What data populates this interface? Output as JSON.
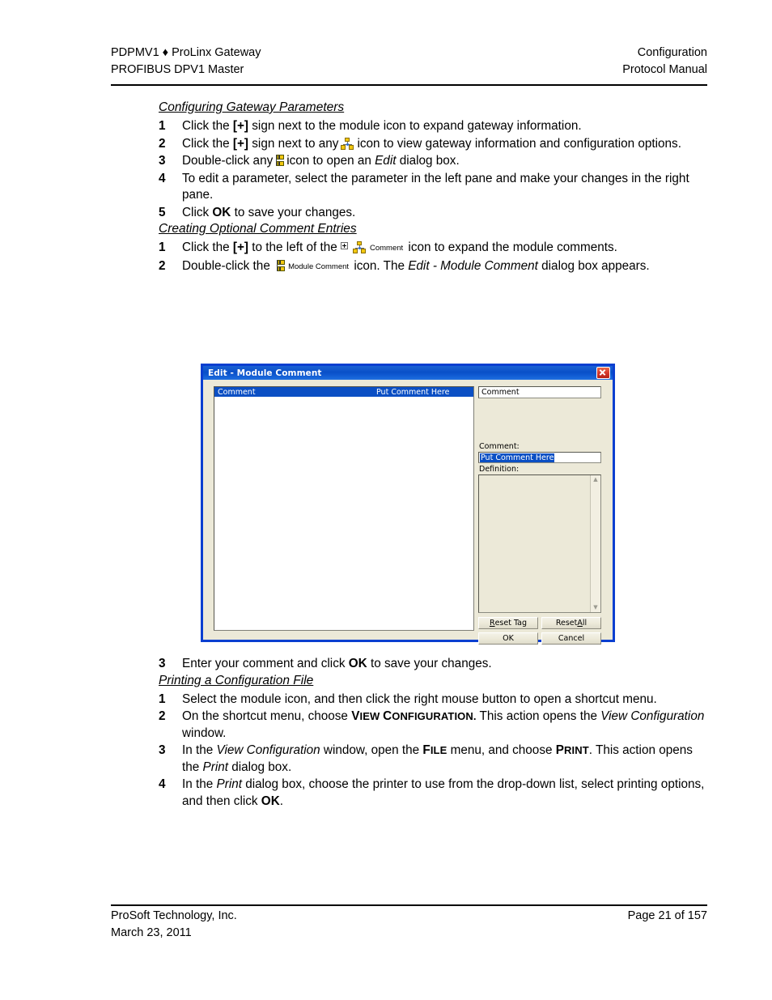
{
  "header": {
    "left_line1": "PDPMV1 ♦ ProLinx Gateway",
    "left_line2": "PROFIBUS DPV1 Master",
    "right_line1": "Configuration",
    "right_line2": "Protocol Manual"
  },
  "sections": [
    {
      "title": "Configuring Gateway Parameters",
      "steps": [
        {
          "num": "1",
          "text": "Click the [+] sign next to the module icon to expand gateway information."
        },
        {
          "num": "2",
          "text": "Click the [+] sign next to any (tree icon) icon to view gateway information and configuration options."
        },
        {
          "num": "3",
          "text": "Double-click any (parameter icon) icon to open an Edit dialog box."
        },
        {
          "num": "4",
          "text": "To edit a parameter, select the parameter in the left pane and make your changes in the right pane."
        },
        {
          "num": "5",
          "text": "Click OK to save your changes."
        }
      ]
    },
    {
      "title": "Creating Optional Comment Entries",
      "steps": [
        {
          "num": "1",
          "text": "Click the [+] to the left of the Comment icon to expand the module comments."
        },
        {
          "num": "2",
          "text": "Double-click the Module Comment icon. The Edit - Module Comment dialog box appears."
        },
        {
          "num": "3",
          "text": "Enter your comment and click OK to save your changes."
        }
      ]
    },
    {
      "title": "Printing a Configuration File",
      "steps": [
        {
          "num": "1",
          "text": "Select the module icon, and then click the right mouse button to open a shortcut menu."
        },
        {
          "num": "2",
          "text": "On the shortcut menu, choose VIEW CONFIGURATION. This action opens the View Configuration window."
        },
        {
          "num": "3",
          "text": "In the View Configuration window, open the FILE menu, and choose PRINT. This action opens the Print dialog box."
        },
        {
          "num": "4",
          "text": "In the Print dialog box, choose the printer to use from the drop-down list, select printing options, and then click OK."
        }
      ]
    }
  ],
  "text_fragments": {
    "s1_step1_a": "Click the ",
    "s1_step1_b": "[+]",
    "s1_step1_c": " sign next to the module icon to expand gateway information.",
    "s1_step2_a": "Click the ",
    "s1_step2_b": "[+]",
    "s1_step2_c": " sign next to any",
    "s1_step2_d": "icon to view gateway information and configuration options.",
    "s1_step3_a": "Double-click any",
    "s1_step3_b": "icon to open an ",
    "s1_step3_c": "Edit",
    "s1_step3_d": " dialog box.",
    "s1_step4": "To edit a parameter, select the parameter in the left pane and make your changes in the right pane.",
    "s1_step5_a": "Click ",
    "s1_step5_b": "OK",
    "s1_step5_c": " to save your changes.",
    "s2_step1_a": "Click the ",
    "s2_step1_b": "[+]",
    "s2_step1_c": " to the left of the",
    "s2_step1_d": "icon to expand the module comments.",
    "s2_step2_a": "Double-click the",
    "s2_step2_b": "icon. The ",
    "s2_step2_c": "Edit - Module Comment",
    "s2_step2_d": " dialog box appears.",
    "s2_step3_a": "Enter your comment and click ",
    "s2_step3_b": "OK",
    "s2_step3_c": " to save your changes.",
    "s3_step1": "Select the module icon, and then click the right mouse button to open a shortcut menu.",
    "s3_step2_a": "On the shortcut menu, choose ",
    "s3_step2_v": "V",
    "s3_step2_iew": "IEW",
    "s3_step2_c": "C",
    "s3_step2_onfig": "ONFIGURATION.",
    "s3_step2_b": " This action opens the ",
    "s3_step2_c2": "View Configuration",
    "s3_step2_d": " window.",
    "s3_step3_a": "In the ",
    "s3_step3_b": "View Configuration",
    "s3_step3_c": " window, open the ",
    "s3_step3_f": "F",
    "s3_step3_ile": "ILE",
    "s3_step3_d": " menu, and choose ",
    "s3_step3_p": "P",
    "s3_step3_rint": "RINT",
    "s3_step3_e": ". This action opens the ",
    "s3_step3_g": "Print",
    "s3_step3_h": " dialog box.",
    "s3_step4_a": "In the ",
    "s3_step4_b": "Print",
    "s3_step4_c": " dialog box, choose the printer to use from the drop-down list, select printing options, and then click ",
    "s3_step4_d": "OK",
    "s3_step4_e": "."
  },
  "inline_icons": {
    "tree_icon_name": "network-tree-icon",
    "param_icon_name": "parameter-icon",
    "comment_label": "Comment",
    "module_comment_label": "Module Comment"
  },
  "dialog": {
    "title": "Edit - Module Comment",
    "close_label": "×",
    "tree": {
      "rows": [
        {
          "name": "Comment",
          "value": "Put Comment Here",
          "selected": true
        }
      ]
    },
    "right_panel": {
      "top_box_value": "Comment",
      "comment_label": "Comment:",
      "comment_value": "Put Comment Here",
      "definition_label": "Definition:",
      "definition_value": "",
      "scroll_up": "▲",
      "scroll_down": "▼"
    },
    "buttons": {
      "reset_tag": {
        "pre": "",
        "accel": "R",
        "post": "eset Tag"
      },
      "reset_all": {
        "pre": "Reset ",
        "accel": "A",
        "post": "ll"
      },
      "ok": "OK",
      "cancel": "Cancel"
    },
    "colors": {
      "titlebar": "#0a50c8",
      "selection": "#0b4fc4",
      "face": "#ece9d8",
      "close": "#d6392c"
    }
  },
  "footer": {
    "left_line1": "ProSoft Technology, Inc.",
    "left_line2": "March 23, 2011",
    "right_line1": "Page 21 of 157",
    "right_line2": ""
  }
}
